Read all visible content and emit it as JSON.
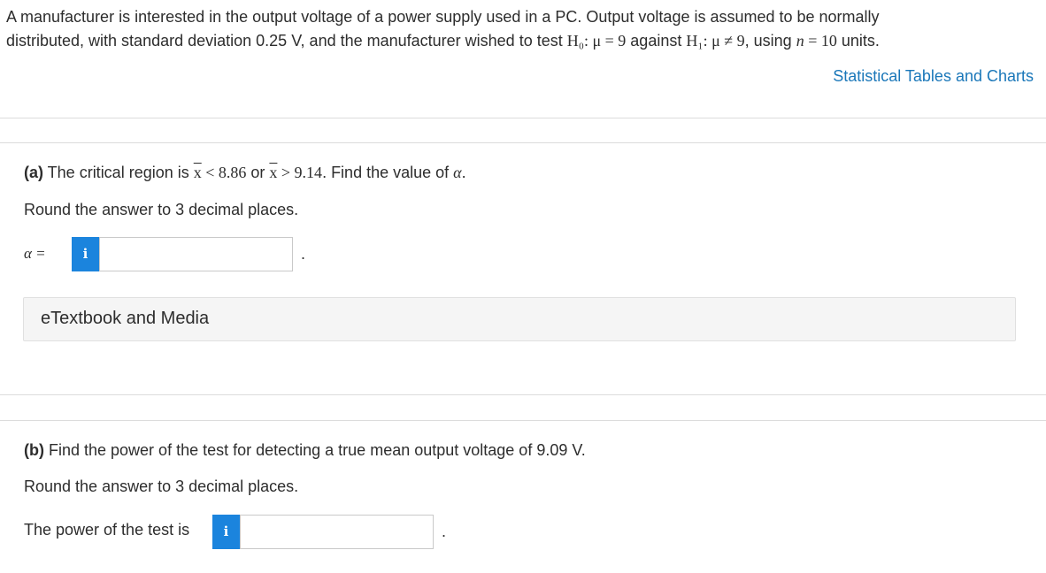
{
  "intro": {
    "line1": "A manufacturer is interested in the output voltage of a power supply used in a PC. Output voltage is assumed to be normally",
    "line2_pre": "distributed, with standard deviation 0.25 V, and the manufacturer wished to test ",
    "h0_math": "H₀: μ = 9",
    "against": " against ",
    "h1_math": "H₁: μ ≠ 9",
    "using": ", using ",
    "n_var": "n",
    "n_eq": " = 10",
    "units": " units."
  },
  "link": {
    "tables": "Statistical Tables and Charts"
  },
  "part_a": {
    "label": "(a)",
    "text1": " The critical region is ",
    "xbar": "x",
    "cond1": " < 8.86",
    "or": " or ",
    "cond2": " > 9.14",
    "text2": ". Find the value of ",
    "alpha": "α",
    "end": ".",
    "round": "Round the answer to 3 decimal places.",
    "input_label": "α =",
    "input_value": "",
    "info": "i",
    "period": "."
  },
  "etextbook": {
    "label": "eTextbook and Media"
  },
  "part_b": {
    "label": "(b)",
    "text": " Find the power of the test for detecting a true mean output voltage of 9.09 V.",
    "round": "Round the answer to 3 decimal places.",
    "input_label": "The power of the test is",
    "input_value": "",
    "info": "i",
    "period": "."
  },
  "colors": {
    "link": "#1a77b9",
    "info_button": "#1b84dd",
    "divider": "#dcdcdc"
  }
}
